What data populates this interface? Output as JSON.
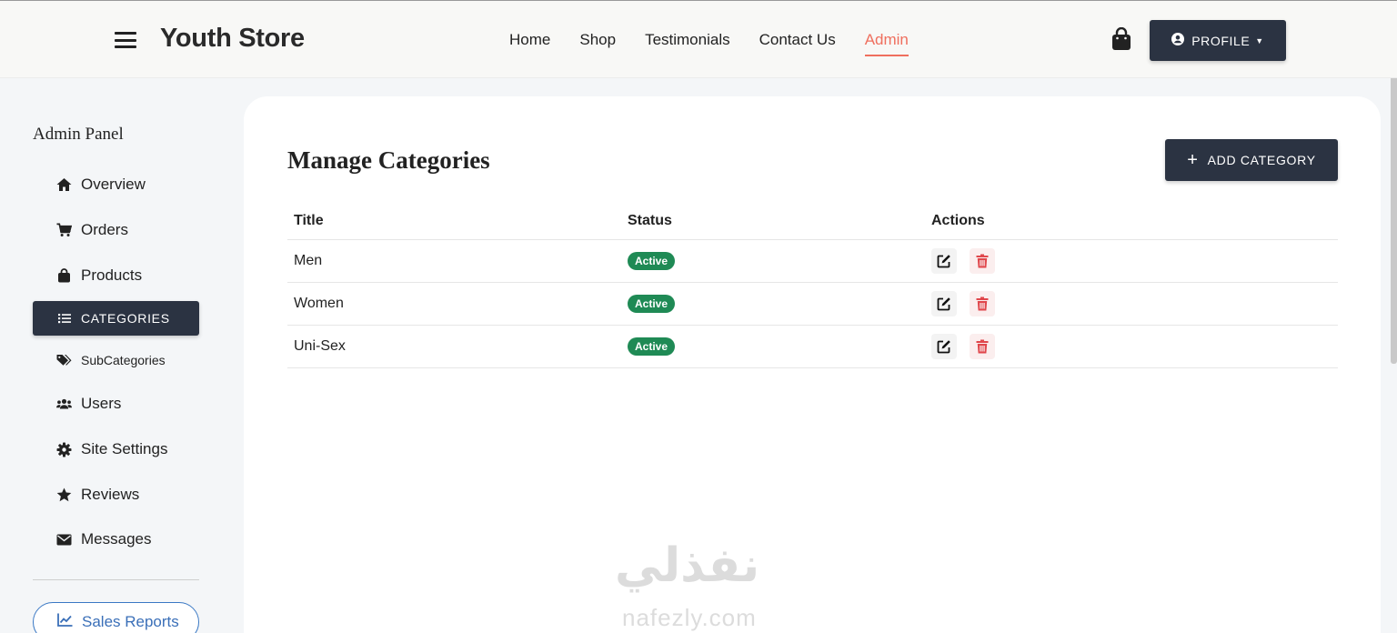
{
  "navbar": {
    "brand": "Youth Store",
    "links": [
      {
        "label": "Home",
        "active": false
      },
      {
        "label": "Shop",
        "active": false
      },
      {
        "label": "Testimonials",
        "active": false
      },
      {
        "label": "Contact Us",
        "active": false
      },
      {
        "label": "Admin",
        "active": true
      }
    ],
    "profile_label": "PROFILE"
  },
  "sidebar": {
    "title": "Admin Panel",
    "items": [
      {
        "label": "Overview",
        "icon": "home-icon"
      },
      {
        "label": "Orders",
        "icon": "cart-icon"
      },
      {
        "label": "Products",
        "icon": "bag-icon"
      },
      {
        "label": "CATEGORIES",
        "icon": "list-icon",
        "active": true
      },
      {
        "label": "SubCategories",
        "icon": "tags-icon"
      },
      {
        "label": "Users",
        "icon": "users-icon"
      },
      {
        "label": "Site Settings",
        "icon": "gear-icon"
      },
      {
        "label": "Reviews",
        "icon": "star-icon"
      },
      {
        "label": "Messages",
        "icon": "envelope-icon"
      }
    ],
    "sales_reports_label": "Sales Reports"
  },
  "main": {
    "title": "Manage Categories",
    "add_button_label": "ADD CATEGORY",
    "table": {
      "headers": [
        "Title",
        "Status",
        "Actions"
      ],
      "rows": [
        {
          "title": "Men",
          "status": "Active"
        },
        {
          "title": "Women",
          "status": "Active"
        },
        {
          "title": "Uni-Sex",
          "status": "Active"
        }
      ]
    }
  },
  "watermark": {
    "arabic": "نفذلي",
    "latin": "nafezly.com"
  },
  "colors": {
    "accent": "#ef6f5e",
    "dark_button": "#2b3342",
    "status_active": "#1f8a55",
    "delete": "#e0474c",
    "link_blue": "#3a6fb8"
  }
}
